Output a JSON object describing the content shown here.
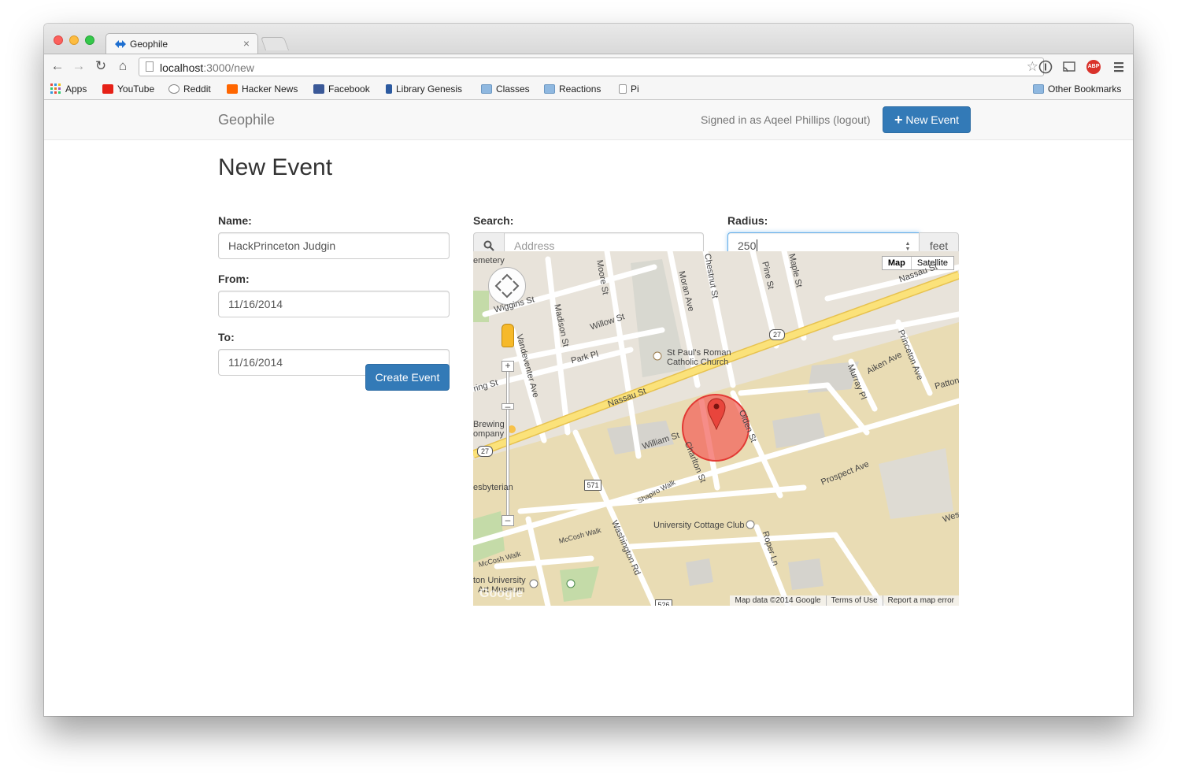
{
  "browser": {
    "tab_title": "Geophile",
    "tab_close": "×",
    "url_host": "localhost",
    "url_rest": ":3000/new",
    "bookmarks": [
      "Apps",
      "YouTube",
      "Reddit",
      "Hacker News",
      "Facebook",
      "Library Genesis",
      "Classes",
      "Reactions",
      "Pi"
    ],
    "other_bookmarks": "Other Bookmarks",
    "extension_abp": "ABP"
  },
  "navbar": {
    "brand": "Geophile",
    "signed_in": "Signed in as Aqeel Phillips (logout)",
    "new_event_button": "New Event",
    "new_event_icon": "+"
  },
  "form": {
    "heading": "New Event",
    "name_label": "Name:",
    "name_value": "HackPrinceton Judgin",
    "from_label": "From:",
    "from_value": "11/16/2014",
    "to_label": "To:",
    "to_value": "11/16/2014",
    "create_button": "Create Event",
    "search_label": "Search:",
    "search_placeholder": "Address",
    "radius_label": "Radius:",
    "radius_value": "250",
    "radius_unit": "feet"
  },
  "map": {
    "type_map": "Map",
    "type_satellite": "Satellite",
    "footer_data": "Map data ©2014 Google",
    "footer_terms": "Terms of Use",
    "footer_report": "Report a map error",
    "logo": "Google",
    "labels": {
      "nassau_st": "Nassau St",
      "nassau_st_2": "Nassau St",
      "st_pauls": "St Paul's Roman",
      "st_pauls_2": "Catholic Church",
      "willow_st": "Willow St",
      "park_pl": "Park Pl",
      "madison_st": "Madison St",
      "vandeventer": "Vandeventer Ave",
      "wiggins": "Wiggins St",
      "moran": "Moran Ave",
      "chestnut": "Chestnut St",
      "pine": "Pine St",
      "maple": "Maple St",
      "moore": "Moore St",
      "cemetery": "emetery",
      "aiken": "Aiken Ave",
      "princeton_ave": "Princeton Ave",
      "murray": "Murray Pl",
      "patton": "Patton",
      "william_st": "William St",
      "charlton": "Charlton St",
      "olden": "Olden St",
      "prospect": "Prospect Ave",
      "shapiro": "Shapiro Walk",
      "washington": "Washington Rd",
      "cottage_club": "University Cottage Club",
      "roper": "Roper Ln",
      "mccosh": "McCosh Walk",
      "mccosh_2": "McCosh Walk",
      "brewing": "Brewing",
      "brewing_2": "ompany",
      "presbyterian": "esbyterian",
      "univ_art": "ton University",
      "univ_art_2": "Art Museum",
      "spring": "ring St",
      "western": "Weste",
      "shield_27a": "27",
      "shield_27b": "27",
      "shield_571": "571",
      "shield_526": "526"
    }
  },
  "colors": {
    "primary": "#337ab7",
    "nassau_road": "#f8d86a",
    "campus": "#e9dcb4",
    "radius_circle": "#f2615a"
  }
}
